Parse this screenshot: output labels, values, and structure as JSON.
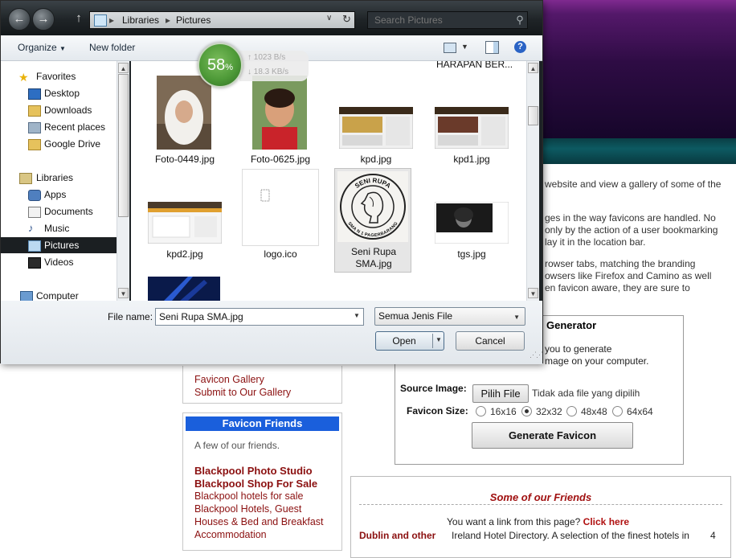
{
  "background_page": {
    "right_text_lines": [
      "website and view a gallery of some of the",
      "ges in the way favicons are handled. No",
      " only by the action of a user bookmarking",
      "lay it in the location bar.",
      "rowser tabs, matching the branding",
      "owsers like Firefox and Camino as well",
      "en favicon aware, they are sure to"
    ],
    "generator": {
      "title": "Generator",
      "desc_lines": [
        "you to generate",
        "mage on your computer."
      ],
      "source_label": "Source Image:",
      "choose_button": "Pilih File",
      "no_file_text": "Tidak ada file yang dipilih",
      "size_label": "Favicon Size:",
      "sizes": [
        "16x16",
        "32x32",
        "48x48",
        "64x64"
      ],
      "selected_size": "32x32",
      "generate_button": "Generate Favicon"
    },
    "gallery_links": [
      "Favicon Gallery",
      "Submit to Our Gallery"
    ],
    "friends": {
      "heading": "Favicon Friends",
      "intro": "A few of our friends.",
      "bold_links": [
        "Blackpool Photo Studio",
        "Blackpool Shop For Sale"
      ],
      "links": [
        "Blackpool hotels for sale",
        "Blackpool Hotels, Guest",
        "Houses & Bed and Breakfast",
        "Accommodation"
      ]
    },
    "some_friends": {
      "title": "Some of our Friends",
      "link_prompt": "You want a link from this page?",
      "click_here": "Click here",
      "dublin": "Dublin and other",
      "ireland_text": "Ireland Hotel Directory. A selection of the finest hotels in",
      "number": "4"
    }
  },
  "dialog": {
    "breadcrumbs": [
      "Libraries",
      "Pictures"
    ],
    "search_placeholder": "Search Pictures",
    "toolbar": {
      "organize": "Organize",
      "new_folder": "New folder"
    },
    "nav_items": [
      {
        "label": "Favorites",
        "icon": "star-icon",
        "group": true
      },
      {
        "label": "Desktop",
        "icon": "desktop-icon"
      },
      {
        "label": "Downloads",
        "icon": "downloads-folder-icon"
      },
      {
        "label": "Recent places",
        "icon": "recent-places-icon"
      },
      {
        "label": "Google Drive",
        "icon": "google-drive-folder-icon"
      },
      {
        "label": "Libraries",
        "icon": "libraries-icon",
        "group": true
      },
      {
        "label": "Apps",
        "icon": "apps-icon"
      },
      {
        "label": "Documents",
        "icon": "documents-icon"
      },
      {
        "label": "Music",
        "icon": "music-icon"
      },
      {
        "label": "Pictures",
        "icon": "pictures-icon",
        "selected": true
      },
      {
        "label": "Videos",
        "icon": "videos-icon"
      },
      {
        "label": "Computer",
        "icon": "computer-icon",
        "group": true
      }
    ],
    "files_header_partial": "HARAPAN BER...",
    "files": [
      {
        "name": "Foto-0449.jpg"
      },
      {
        "name": "Foto-0625.jpg"
      },
      {
        "name": "kpd.jpg"
      },
      {
        "name": "kpd1.jpg"
      },
      {
        "name": "kpd2.jpg"
      },
      {
        "name": "logo.ico"
      },
      {
        "name": "Seni Rupa SMA.jpg",
        "line1": "Seni Rupa",
        "line2": "SMA.jpg",
        "selected": true
      },
      {
        "name": "tgs.jpg"
      }
    ],
    "file_name_label": "File name:",
    "file_name_value": "Seni Rupa SMA.jpg",
    "file_type": "Semua Jenis File",
    "open_button": "Open",
    "cancel_button": "Cancel",
    "seni_rupa_logo": {
      "top_text": "SENI RUPA",
      "bottom_text": "SMA N 1 PAGERBARANG"
    }
  },
  "speed_widget": {
    "percent": "58",
    "percent_sign": "%",
    "upload": "1023 B/s",
    "download": "18.3 KB/s"
  },
  "colors": {
    "favicon_friends_header": "#1a5fdc",
    "link_red": "#8b1010",
    "dialog_title_dark": "#1f2427",
    "speed_green": "#4e9a38"
  }
}
